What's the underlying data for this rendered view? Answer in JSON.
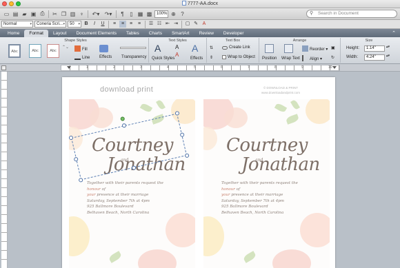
{
  "window": {
    "title": "7777-AA.docx",
    "light_colors": [
      "#ff5f57",
      "#febc2e",
      "#28c840"
    ]
  },
  "toolbar": {
    "icons": [
      "new-icon",
      "templates-icon",
      "open-icon",
      "save-icon",
      "print-icon",
      "cut-icon",
      "copy-icon",
      "paste-icon",
      "format-painter-icon",
      "undo-icon",
      "redo-icon",
      "paragraph-icon",
      "sidebar-icon",
      "gallery-icon",
      "toolbox-icon",
      "zoom-in-icon",
      "help-icon"
    ],
    "zoom": "100%",
    "search_placeholder": "Search in Document"
  },
  "formatting": {
    "style": "Normal",
    "font": "Coneria Scri...",
    "size": "50",
    "bold": "B",
    "italic": "I",
    "underline": "U"
  },
  "tabs": [
    {
      "label": "Home",
      "active": false
    },
    {
      "label": "Format",
      "active": true
    },
    {
      "label": "Layout",
      "active": false
    },
    {
      "label": "Document Elements",
      "active": false
    },
    {
      "label": "Tables",
      "active": false
    },
    {
      "label": "Charts",
      "active": false
    },
    {
      "label": "SmartArt",
      "active": false
    },
    {
      "label": "Review",
      "active": false
    },
    {
      "label": "Developer",
      "active": false
    }
  ],
  "ribbon": {
    "shape_styles": {
      "title": "Shape Styles",
      "swatch": "Abc",
      "fill": "Fill",
      "line": "Line",
      "effects": "Effects",
      "transparency": "Transparency"
    },
    "text_styles": {
      "title": "Text Styles",
      "quick_styles": "Quick Styles",
      "effects": "Effects"
    },
    "text_box": {
      "title": "Text Box",
      "create_link": "Create Link",
      "wrap_to_object": "Wrap to Object"
    },
    "arrange": {
      "title": "Arrange",
      "position": "Position",
      "wrap_text": "Wrap Text",
      "reorder": "Reorder",
      "align": "Align"
    },
    "size": {
      "title": "Size",
      "height_label": "Height:",
      "height": "1.14\"",
      "width_label": "Width:",
      "width": "4.24\""
    }
  },
  "ruler": {
    "numbers": [
      "1",
      "2",
      "3",
      "4",
      "5",
      "6",
      "7",
      "8",
      "9",
      "10"
    ]
  },
  "document": {
    "brand": "download print",
    "brand_sub_line1": "© DOWNLOAD & PRINT",
    "brand_sub_line2": "www.downloadandprint.com",
    "invitation": {
      "name1": "Courtney",
      "and": "and",
      "name2": "Jonathan",
      "line1a": "Together with their parents request the ",
      "line1_hi": "honour",
      "line1b": " of",
      "line2a": "your",
      "line2b": " presence at their marriage",
      "line3": "Saturday, September 7th at 4pm",
      "line4": "925 Ballmore Boulevard",
      "line5": "Belhaven Beach, North Carolina"
    }
  },
  "colors": {
    "accent": "#5b7fb3",
    "script_text": "#7d6f67",
    "highlight": "#c9826f",
    "rose": "#f7cfc6",
    "peach": "#fbe3c7",
    "leaf": "#cfe0b8"
  }
}
